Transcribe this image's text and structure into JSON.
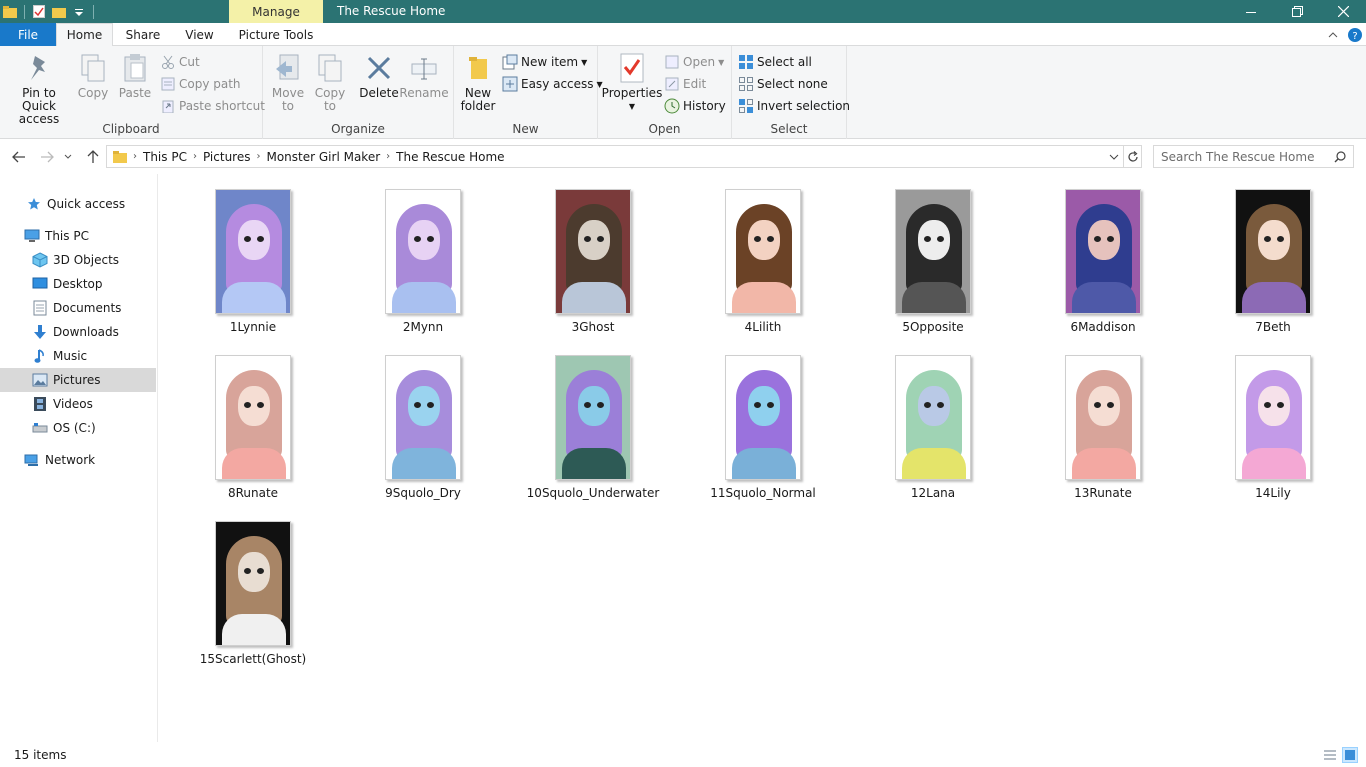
{
  "window": {
    "title": "The Rescue Home",
    "context_tab": "Manage"
  },
  "ribbon_tabs": {
    "file": "File",
    "home": "Home",
    "share": "Share",
    "view": "View",
    "picture_tools": "Picture Tools"
  },
  "clipboard": {
    "group_label": "Clipboard",
    "pin_line1": "Pin to Quick",
    "pin_line2": "access",
    "copy": "Copy",
    "paste": "Paste",
    "cut": "Cut",
    "copy_path": "Copy path",
    "paste_shortcut": "Paste shortcut"
  },
  "organize": {
    "group_label": "Organize",
    "move_to_line1": "Move",
    "move_to_line2": "to",
    "copy_to_line1": "Copy",
    "copy_to_line2": "to",
    "delete": "Delete",
    "rename": "Rename"
  },
  "new_group": {
    "group_label": "New",
    "new_folder_line1": "New",
    "new_folder_line2": "folder",
    "new_item": "New item",
    "easy_access": "Easy access"
  },
  "open_group": {
    "group_label": "Open",
    "properties": "Properties",
    "open": "Open",
    "edit": "Edit",
    "history": "History"
  },
  "select_group": {
    "group_label": "Select",
    "select_all": "Select all",
    "select_none": "Select none",
    "invert_selection": "Invert selection"
  },
  "breadcrumb": [
    "This PC",
    "Pictures",
    "Monster Girl Maker",
    "The Rescue Home"
  ],
  "search": {
    "placeholder": "Search The Rescue Home"
  },
  "nav": {
    "quick_access": "Quick access",
    "this_pc": "This PC",
    "objects3d": "3D Objects",
    "desktop": "Desktop",
    "documents": "Documents",
    "downloads": "Downloads",
    "music": "Music",
    "pictures": "Pictures",
    "videos": "Videos",
    "os_c": "OS (C:)",
    "network": "Network"
  },
  "files": [
    {
      "name": "1Lynnie",
      "hair": "#b58be0",
      "bg": "#6f86c9",
      "skin": "#e9d6f5",
      "body": "#b4c8f5"
    },
    {
      "name": "2Mynn",
      "hair": "#a98ad9",
      "bg": "#ffffff",
      "skin": "#e7d2f4",
      "body": "#a9c0f0"
    },
    {
      "name": "3Ghost",
      "hair": "#4c3b2e",
      "bg": "#7a3a3a",
      "skin": "#d8d0c6",
      "body": "#b9c6d8"
    },
    {
      "name": "4Lilith",
      "hair": "#6b4226",
      "bg": "#ffffff",
      "skin": "#f3d2c2",
      "body": "#f2b7a8"
    },
    {
      "name": "5Opposite",
      "hair": "#2a2a2a",
      "bg": "#9a9a9a",
      "skin": "#ededed",
      "body": "#555555"
    },
    {
      "name": "6Maddison",
      "hair": "#2f3d8f",
      "bg": "#9b5aa8",
      "skin": "#e6c2bd",
      "body": "#4e59a8"
    },
    {
      "name": "7Beth",
      "hair": "#7a5a3c",
      "bg": "#111111",
      "skin": "#f4dccd",
      "body": "#8c6ab5"
    },
    {
      "name": "8Runate",
      "hair": "#d8a49a",
      "bg": "#ffffff",
      "skin": "#f5ddd3",
      "body": "#f3a8a2"
    },
    {
      "name": "9Squolo_Dry",
      "hair": "#a78ddc",
      "bg": "#ffffff",
      "skin": "#9ad3ef",
      "body": "#7fb4dc"
    },
    {
      "name": "10Squolo_Underwater",
      "hair": "#9b7fd8",
      "bg": "#9ec7b2",
      "skin": "#8acbe8",
      "body": "#2d5a55"
    },
    {
      "name": "11Squolo_Normal",
      "hair": "#9a72dd",
      "bg": "#ffffff",
      "skin": "#8fd0ee",
      "body": "#7ab0d8"
    },
    {
      "name": "12Lana",
      "hair": "#9fd3b4",
      "bg": "#ffffff",
      "skin": "#b9c9e6",
      "body": "#e4e46a"
    },
    {
      "name": "13Runate",
      "hair": "#d8a49a",
      "bg": "#ffffff",
      "skin": "#f5ddd3",
      "body": "#f3a8a2"
    },
    {
      "name": "14Lily",
      "hair": "#c39ae8",
      "bg": "#ffffff",
      "skin": "#f6e1ea",
      "body": "#f4a8d4"
    },
    {
      "name": "15Scarlett(Ghost)",
      "hair": "#a88566",
      "bg": "#111111",
      "skin": "#e8ddd2",
      "body": "#f0f0f0"
    }
  ],
  "status": {
    "item_count": "15 items"
  },
  "colors": {
    "titlebar": "#2b7373",
    "file_tab": "#1979ca",
    "manage_tab": "#f4f1a8",
    "selected_nav": "#d9d9d9"
  }
}
